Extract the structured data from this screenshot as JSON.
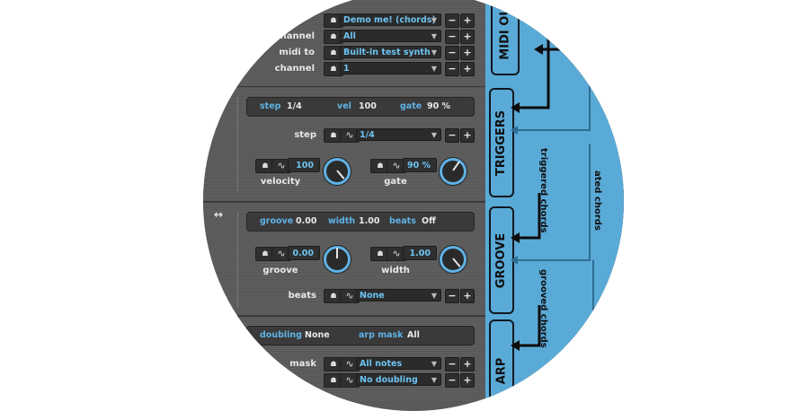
{
  "top_rows": [
    {
      "label": "",
      "value": "Demo me! (chords)"
    },
    {
      "label": "channel",
      "value": "All"
    },
    {
      "label": "midi to",
      "value": "Built-in test synth"
    },
    {
      "label": "channel",
      "value": "1"
    }
  ],
  "triggers": {
    "summary": {
      "step_key": "step",
      "step_val": "1/4",
      "vel_key": "vel",
      "vel_val": "100",
      "gate_key": "gate",
      "gate_val": "90 %"
    },
    "step_label": "step",
    "step_value": "1/4",
    "velocity": {
      "value": "100",
      "label": "velocity"
    },
    "gate": {
      "value": "90 %",
      "label": "gate"
    }
  },
  "groove": {
    "summary": {
      "groove_key": "groove",
      "groove_val": "0.00",
      "width_key": "width",
      "width_val": "1.00",
      "beats_key": "beats",
      "beats_val": "Off"
    },
    "groove_knob": {
      "value": "0.00",
      "label": "groove"
    },
    "width_knob": {
      "value": "1.00",
      "label": "width"
    },
    "beats_label": "beats",
    "beats_value": "None"
  },
  "arp": {
    "summary": {
      "doubling_key": "doubling",
      "doubling_val": "None",
      "mask_key": "arp mask",
      "mask_val": "All"
    },
    "rows": [
      {
        "label": "mask",
        "value": "All notes"
      },
      {
        "label": "",
        "value": "No doubling"
      }
    ]
  },
  "buttons": {
    "minus": "−",
    "plus": "+"
  },
  "glyphs": {
    "pad": "☗",
    "wave": "∿",
    "arrow": "▼",
    "groove_icon": "↔"
  },
  "diagram": {
    "midi_out": "MIDI OUT",
    "triggers": "TRIGGERS",
    "groove": "GROOVE",
    "arp": "ARP",
    "triggered_chords": "triggered chords",
    "grooved_chords": "grooved chords",
    "side_label": "ated chords"
  },
  "colors": {
    "accent": "#5fb2e6",
    "panel": "#5c5c5c",
    "diagram_bg": "#5aaad7"
  }
}
